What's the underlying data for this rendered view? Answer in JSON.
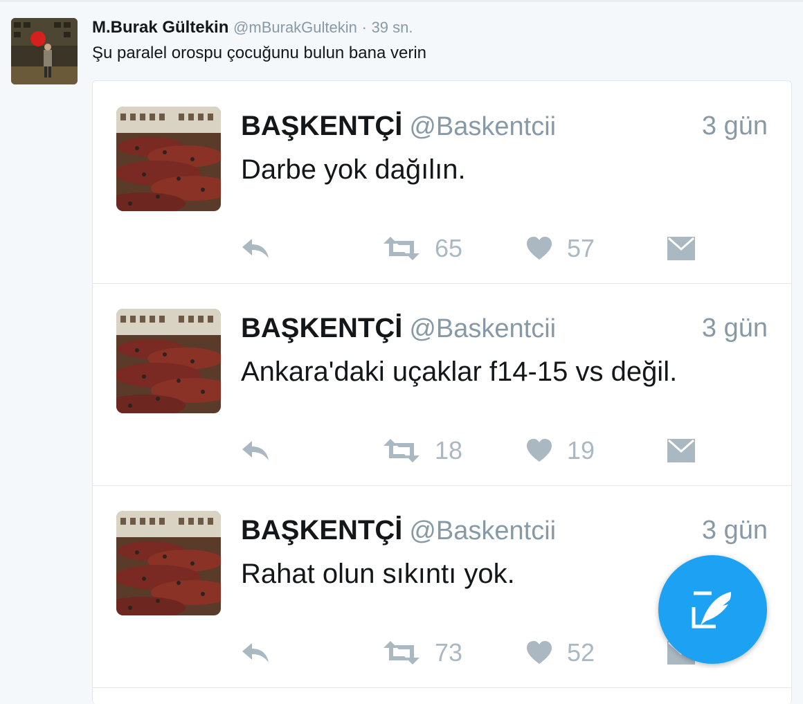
{
  "main_tweet": {
    "author_name": "M.Burak Gültekin",
    "handle": "@mBurakGultekin",
    "separator": "·",
    "time": "39 sn.",
    "text": "Şu paralel orospu çocuğunu bulun bana verin"
  },
  "quoted": [
    {
      "name": "BAŞKENTÇİ",
      "handle": "@Baskentcii",
      "time": "3 gün",
      "text": "Darbe yok dağılın.",
      "retweets": "65",
      "likes": "57"
    },
    {
      "name": "BAŞKENTÇİ",
      "handle": "@Baskentcii",
      "time": "3 gün",
      "text": "Ankara'daki uçaklar f14-15 vs değil.",
      "retweets": "18",
      "likes": "19"
    },
    {
      "name": "BAŞKENTÇİ",
      "handle": "@Baskentcii",
      "time": "3 gün",
      "text": "Rahat olun sıkıntı yok.",
      "retweets": "73",
      "likes": "52"
    }
  ],
  "icons": {
    "reply": "reply-icon",
    "retweet": "retweet-icon",
    "like": "heart-icon",
    "dm": "envelope-icon",
    "compose": "compose-tweet-icon"
  },
  "colors": {
    "background": "#f5f8fa",
    "action_gray": "#aab8c2",
    "compose_blue": "#1da1f2",
    "handle_gray": "#8899a6"
  }
}
